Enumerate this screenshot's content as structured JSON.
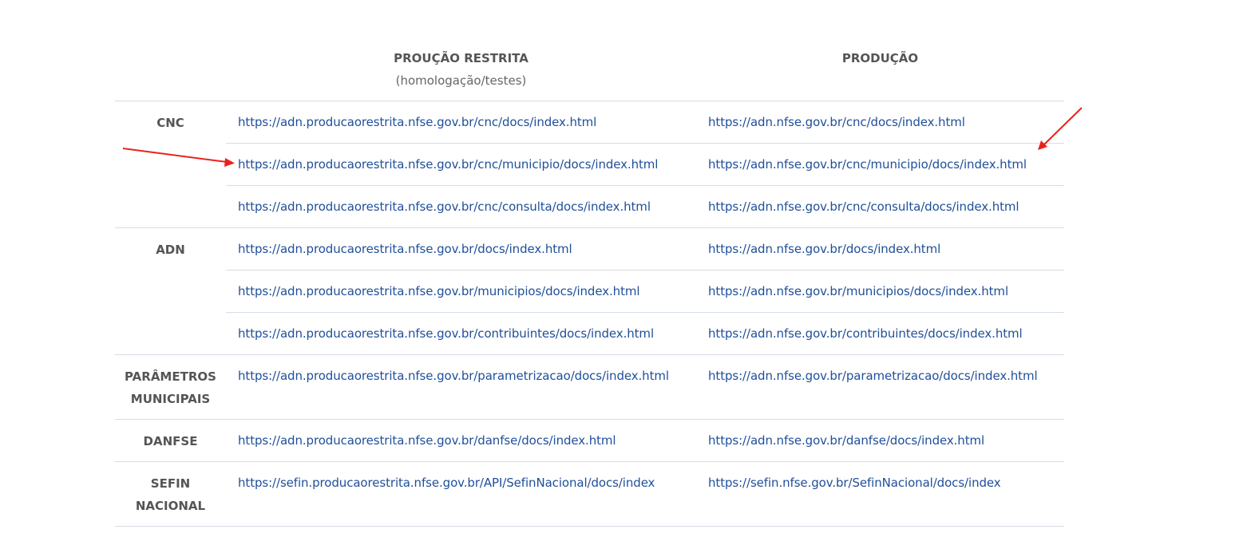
{
  "table": {
    "header_restrita_title": "PROUÇÃO RESTRITA",
    "header_restrita_sub": "(homologação/testes)",
    "header_producao_title": "PRODUÇÃO",
    "groups": [
      {
        "service": "CNC",
        "rows": [
          [
            "https://adn.producaorestrita.nfse.gov.br/cnc/docs/index.html",
            "https://adn.nfse.gov.br/cnc/docs/index.html"
          ],
          [
            "https://adn.producaorestrita.nfse.gov.br/cnc/municipio/docs/index.html",
            "https://adn.nfse.gov.br/cnc/municipio/docs/index.html"
          ],
          [
            "https://adn.producaorestrita.nfse.gov.br/cnc/consulta/docs/index.html",
            "https://adn.nfse.gov.br/cnc/consulta/docs/index.html"
          ]
        ]
      },
      {
        "service": "ADN",
        "rows": [
          [
            "https://adn.producaorestrita.nfse.gov.br/docs/index.html",
            "https://adn.nfse.gov.br/docs/index.html"
          ],
          [
            "https://adn.producaorestrita.nfse.gov.br/municipios/docs/index.html",
            "https://adn.nfse.gov.br/municipios/docs/index.html"
          ],
          [
            "https://adn.producaorestrita.nfse.gov.br/contribuintes/docs/index.html",
            "https://adn.nfse.gov.br/contribuintes/docs/index.html"
          ]
        ]
      },
      {
        "service": "PARÂMETROS MUNICIPAIS",
        "rows": [
          [
            "https://adn.producaorestrita.nfse.gov.br/parametrizacao/docs/index.html",
            "https://adn.nfse.gov.br/parametrizacao/docs/index.html"
          ]
        ]
      },
      {
        "service": "DANFSE",
        "rows": [
          [
            "https://adn.producaorestrita.nfse.gov.br/danfse/docs/index.html",
            "https://adn.nfse.gov.br/danfse/docs/index.html"
          ]
        ]
      },
      {
        "service": "SEFIN NACIONAL",
        "rows": [
          [
            "https://sefin.producaorestrita.nfse.gov.br/API/SefinNacional/docs/index",
            "https://sefin.nfse.gov.br/SefinNacional/docs/index"
          ]
        ]
      }
    ]
  },
  "annotations": {
    "arrow_color": "#e8231a"
  },
  "colors": {
    "link": "#1f4f9a",
    "header_text": "#555555",
    "divider": "#d5dde6"
  }
}
